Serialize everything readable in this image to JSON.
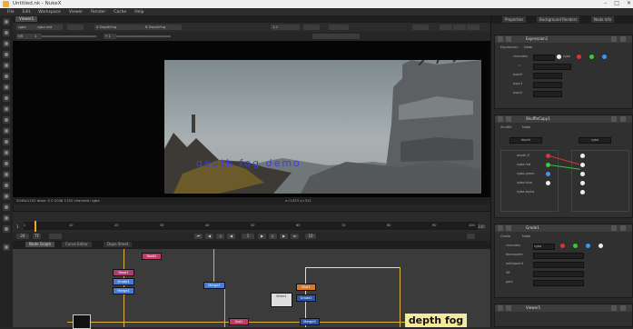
{
  "titlebar": {
    "title": "Untitled.nk - NukeX",
    "controls": [
      "–",
      "□",
      "✕"
    ]
  },
  "menu": [
    "File",
    "Edit",
    "Workspace",
    "Viewer",
    "Render",
    "Cache",
    "Help"
  ],
  "viewer": {
    "tabs": [
      "Viewer1"
    ],
    "channels_label": "rgba",
    "channels_value": "rgba.red",
    "layer_value": "A DepthFog",
    "compare_value": "B DepthFog",
    "zoom_value": "1:1",
    "frame_label": "1",
    "gain_label": "f/8",
    "gamma_label": "Y 1",
    "status_text": "2048x1152 bbox: 0 0 2048 1152 channels: rgba",
    "status_right": "x=1423 y=311",
    "overlay_text": "depth fog demo"
  },
  "timeline": {
    "start_frame": "1",
    "end_frame": "100",
    "ticks": [
      "1",
      "10",
      "20",
      "30",
      "40",
      "50",
      "60",
      "70",
      "80",
      "90",
      "100"
    ],
    "fps": "24",
    "playback_label": "TF",
    "frame_field": "1",
    "step_field": "10"
  },
  "nodegraph": {
    "tabs": [
      "Node Graph",
      "Curve Editor",
      "Dope Sheet"
    ],
    "nodes": [
      {
        "label": "Read2",
        "color": "#c43a6a"
      },
      {
        "label": "Read1",
        "color": "#b03a72"
      },
      {
        "label": "Grade1",
        "color": "#4a7bd6"
      },
      {
        "label": "Merge1",
        "color": "#4a7bd6"
      },
      {
        "label": "Blur1",
        "color": "#d87a2a"
      },
      {
        "label": "Merge2",
        "color": "#4a7bd6"
      },
      {
        "label": "Write1",
        "color": "#ddd"
      },
      {
        "label": "Grade2",
        "color": "#2f55a8"
      },
      {
        "label": "Merge3",
        "color": "#2f55a8"
      },
      {
        "label": "Dot1",
        "color": "#c43a6a"
      }
    ],
    "sticky_note": "depth fog"
  },
  "properties": {
    "tabs": [
      "Properties",
      "Background Renders",
      "Node Info"
    ],
    "panel1": {
      "title": "Expression1",
      "tabs": [
        "Expression",
        "Node"
      ],
      "rows": [
        "channels",
        "=",
        "expr0",
        "expr1",
        "expr2"
      ],
      "checks": [
        "rgba",
        "red",
        "green",
        "blue"
      ]
    },
    "panel2": {
      "title": "ShuffleCopy1",
      "tabs": [
        "Shuffle",
        "Node"
      ],
      "in1": "depth",
      "in2": "rgba",
      "rows": [
        "depth.Z",
        "rgba.red",
        "rgba.green",
        "rgba.blue",
        "rgba.alpha"
      ]
    },
    "panel3": {
      "title": "Grade1",
      "tabs": [
        "Grade",
        "Node"
      ],
      "rows": [
        "channels",
        "blackpoint",
        "whitepoint",
        "lift",
        "gain"
      ],
      "value": "rgba"
    },
    "panel4": {
      "title": "Viewer1"
    }
  },
  "colors": {
    "accent": "#f5a623",
    "sticky": "#f5ea9a"
  }
}
